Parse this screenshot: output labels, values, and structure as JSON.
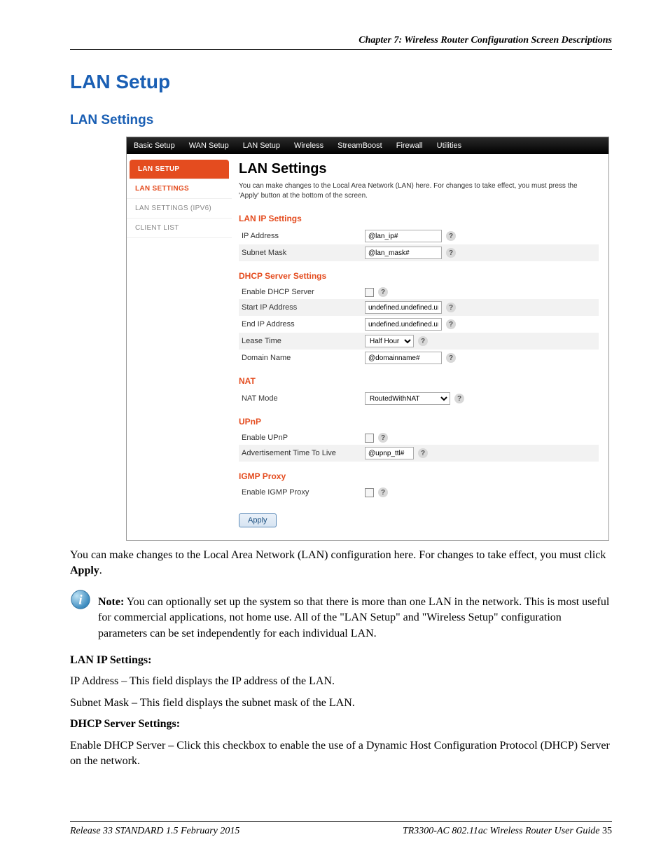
{
  "chapter_header": "Chapter 7: Wireless Router Configuration Screen Descriptions",
  "h1": "LAN Setup",
  "h2": "LAN Settings",
  "screenshot": {
    "tabs": [
      "Basic Setup",
      "WAN Setup",
      "LAN Setup",
      "Wireless",
      "StreamBoost",
      "Firewall",
      "Utilities"
    ],
    "sidebar": [
      "LAN SETUP",
      "LAN SETTINGS",
      "LAN SETTINGS (IPV6)",
      "CLIENT LIST"
    ],
    "panel_title": "LAN Settings",
    "panel_desc": "You can make changes to the Local Area Network (LAN) here. For changes to take effect, you must press the 'Apply' button at the bottom of the screen.",
    "sections": {
      "lan_ip": {
        "title": "LAN IP Settings",
        "ip_label": "IP Address",
        "ip_value": "@lan_ip#",
        "mask_label": "Subnet Mask",
        "mask_value": "@lan_mask#"
      },
      "dhcp": {
        "title": "DHCP Server Settings",
        "enable_label": "Enable DHCP Server",
        "start_label": "Start IP Address",
        "start_value": "undefined.undefined.und",
        "end_label": "End IP Address",
        "end_value": "undefined.undefined.und",
        "lease_label": "Lease Time",
        "lease_value": "Half Hour",
        "domain_label": "Domain Name",
        "domain_value": "@domainname#"
      },
      "nat": {
        "title": "NAT",
        "mode_label": "NAT Mode",
        "mode_value": "RoutedWithNAT"
      },
      "upnp": {
        "title": "UPnP",
        "enable_label": "Enable UPnP",
        "ttl_label": "Advertisement Time To Live",
        "ttl_value": "@upnp_ttl#"
      },
      "igmp": {
        "title": "IGMP Proxy",
        "enable_label": "Enable IGMP Proxy"
      }
    },
    "apply": "Apply"
  },
  "body": {
    "p1_a": "You can make changes to the Local Area Network (LAN) configuration here. For changes to take effect, you must click ",
    "p1_b": "Apply",
    "p1_c": ".",
    "note_label": "Note:",
    "note_text": "  You can optionally set up the system so that there is more than one LAN in the network. This is most useful for commercial applications, not home use. All of the \"LAN Setup\" and \"Wireless Setup\" configuration parameters can be set independently for each individual LAN.",
    "sec1_head": "LAN IP Settings:",
    "sec1_p1": "IP Address – This field displays the IP address of the LAN.",
    "sec1_p2": "Subnet Mask – This field displays the subnet mask of the LAN.",
    "sec2_head": "DHCP Server Settings:",
    "sec2_p1": "Enable DHCP Server – Click this checkbox to enable the use of a Dynamic Host Configuration Protocol (DHCP) Server on the network."
  },
  "footer": {
    "left": "Release 33 STANDARD 1.5    February 2015",
    "right_a": "TR3300-AC 802.11ac Wireless Router User Guide   ",
    "right_b": "35"
  }
}
